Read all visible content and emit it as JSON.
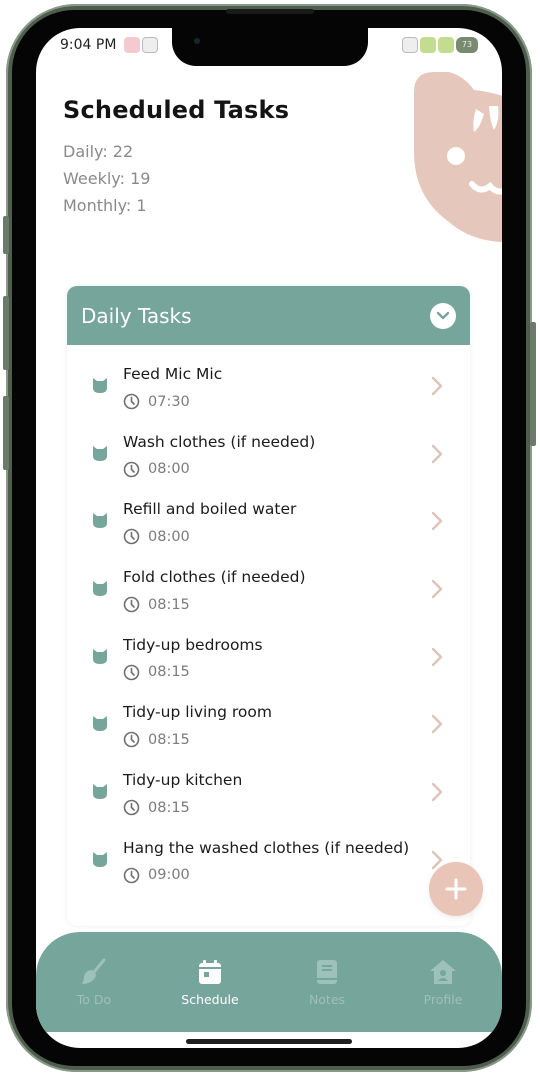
{
  "status_bar": {
    "time": "9:04 PM",
    "battery": "73"
  },
  "header": {
    "title": "Scheduled Tasks",
    "stats": [
      {
        "label": "Daily: 22"
      },
      {
        "label": "Weekly: 19"
      },
      {
        "label": "Monthly: 1"
      }
    ]
  },
  "section": {
    "title": "Daily Tasks",
    "toggle_icon": "chevron-down-icon"
  },
  "tasks": [
    {
      "name": "Feed Mic Mic",
      "time": "07:30"
    },
    {
      "name": "Wash clothes (if needed)",
      "time": "08:00"
    },
    {
      "name": "Refill and boiled water",
      "time": "08:00"
    },
    {
      "name": "Fold clothes (if needed)",
      "time": "08:15"
    },
    {
      "name": "Tidy-up bedrooms",
      "time": "08:15"
    },
    {
      "name": "Tidy-up living room",
      "time": "08:15"
    },
    {
      "name": "Tidy-up kitchen",
      "time": "08:15"
    },
    {
      "name": "Hang the washed clothes (if needed)",
      "time": "09:00"
    }
  ],
  "fab": {
    "icon": "plus-icon"
  },
  "tab_bar": {
    "tabs": [
      {
        "label": "To Do",
        "icon": "broom-icon",
        "active": false
      },
      {
        "label": "Schedule",
        "icon": "calendar-icon",
        "active": true
      },
      {
        "label": "Notes",
        "icon": "notebook-icon",
        "active": false
      },
      {
        "label": "Profile",
        "icon": "home-user-icon",
        "active": false
      }
    ]
  },
  "colors": {
    "primary": "#76a59b",
    "accent": "#e8c5b7",
    "chevron": "#d9c2b8",
    "text": "#1b1b1b",
    "muted": "#8a8a8a"
  }
}
